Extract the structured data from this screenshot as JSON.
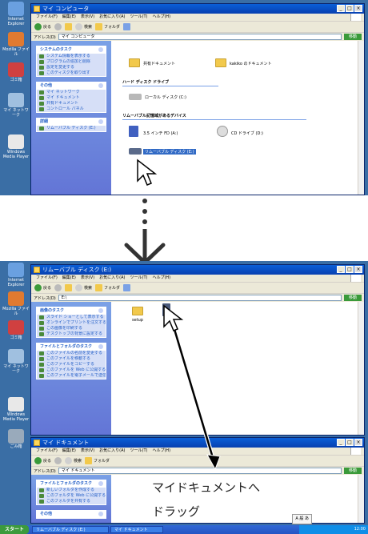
{
  "top_screenshot": {
    "desktop_icons": [
      "Internet Explorer",
      "Mozilla ファイル",
      "ゴミ箱",
      "マイ ネットワーク",
      "Windows Media Player"
    ],
    "window": {
      "title": "マイ コンピュータ",
      "menu": [
        "ファイル(F)",
        "編集(E)",
        "表示(V)",
        "お気に入り(A)",
        "ツール(T)",
        "ヘルプ(H)"
      ],
      "toolbar": [
        "戻る",
        "検索",
        "フォルダ"
      ],
      "address_label": "アドレス(D)",
      "address_value": "マイ コンピュータ",
      "go_label": "移動",
      "task_boxes": [
        {
          "title": "システムのタスク",
          "items": [
            "システム情報を表示する",
            "プログラムの追加と削除",
            "設定を変更する",
            "このディスクを取り出す"
          ]
        },
        {
          "title": "その他",
          "items": [
            "マイ ネットワーク",
            "マイ ドキュメント",
            "共有ドキュメント",
            "コントロール パネル"
          ]
        },
        {
          "title": "詳細",
          "items": [
            "リムーバブル ディスク (E:)"
          ]
        }
      ],
      "folders": [
        "共有ドキュメント",
        "kakiko のドキュメント"
      ],
      "section_hdd": "ハード ディスク ドライブ",
      "hdd": "ローカル ディスク (C:)",
      "section_removable": "リムーバブル記憶域があるデバイス",
      "removable": [
        "3.5 インチ FD (A:)",
        "CD ドライブ (D:)",
        "リムーバブル ディスク (E:)"
      ]
    }
  },
  "bottom_screenshot": {
    "desktop_icons": [
      "Internet Explorer",
      "Mozilla ファイル",
      "ゴミ箱",
      "マイ ネットワーク",
      "Windows Media Player",
      "ごみ箱"
    ],
    "window": {
      "title": "リムーバブル ディスク (E:)",
      "menu": [
        "ファイル(F)",
        "編集(E)",
        "表示(V)",
        "お気に入り(A)",
        "ツール(T)",
        "ヘルプ(H)"
      ],
      "toolbar": [
        "戻る",
        "検索",
        "フォルダ"
      ],
      "address_label": "アドレス(D)",
      "address_value": "E:\\",
      "go_label": "移動",
      "task_boxes": [
        {
          "title": "画像のタスク",
          "items": [
            "スライド ショーとして表示する",
            "オンラインでプリントを注文する",
            "この画像を印刷する",
            "デスクトップの背景に設定する"
          ]
        },
        {
          "title": "ファイルとフォルダのタスク",
          "items": [
            "このファイルの名前を変更する",
            "このファイルを移動する",
            "このファイルをコピーする",
            "このファイルを Web に公開する",
            "このファイルを電子メールで送信する"
          ]
        }
      ],
      "files": [
        "setup",
        ""
      ]
    },
    "second_window": {
      "title": "マイ ドキュメント",
      "address_value": "マイ ドキュメント",
      "task_boxes": [
        {
          "title": "ファイルとフォルダのタスク",
          "items": [
            "新しいフォルダを作成する",
            "このフォルダを Web に公開する",
            "このフォルダを共有する"
          ]
        },
        {
          "title": "その他",
          "items": []
        }
      ]
    },
    "caption_line1": "マイドキュメントへ",
    "caption_line2": "ドラッグ",
    "taskbar": {
      "start": "スタート",
      "tasks": [
        "リムーバブル ディスク (E:)",
        "マイ ドキュメント"
      ],
      "ime": "A 般 あ",
      "tray": "12:00"
    }
  },
  "colors": {
    "desktop": "#3a6ea5",
    "titlebar": "#0a5fd8",
    "taskpane": "#7aa1e6",
    "highlight": "#316ac5"
  }
}
